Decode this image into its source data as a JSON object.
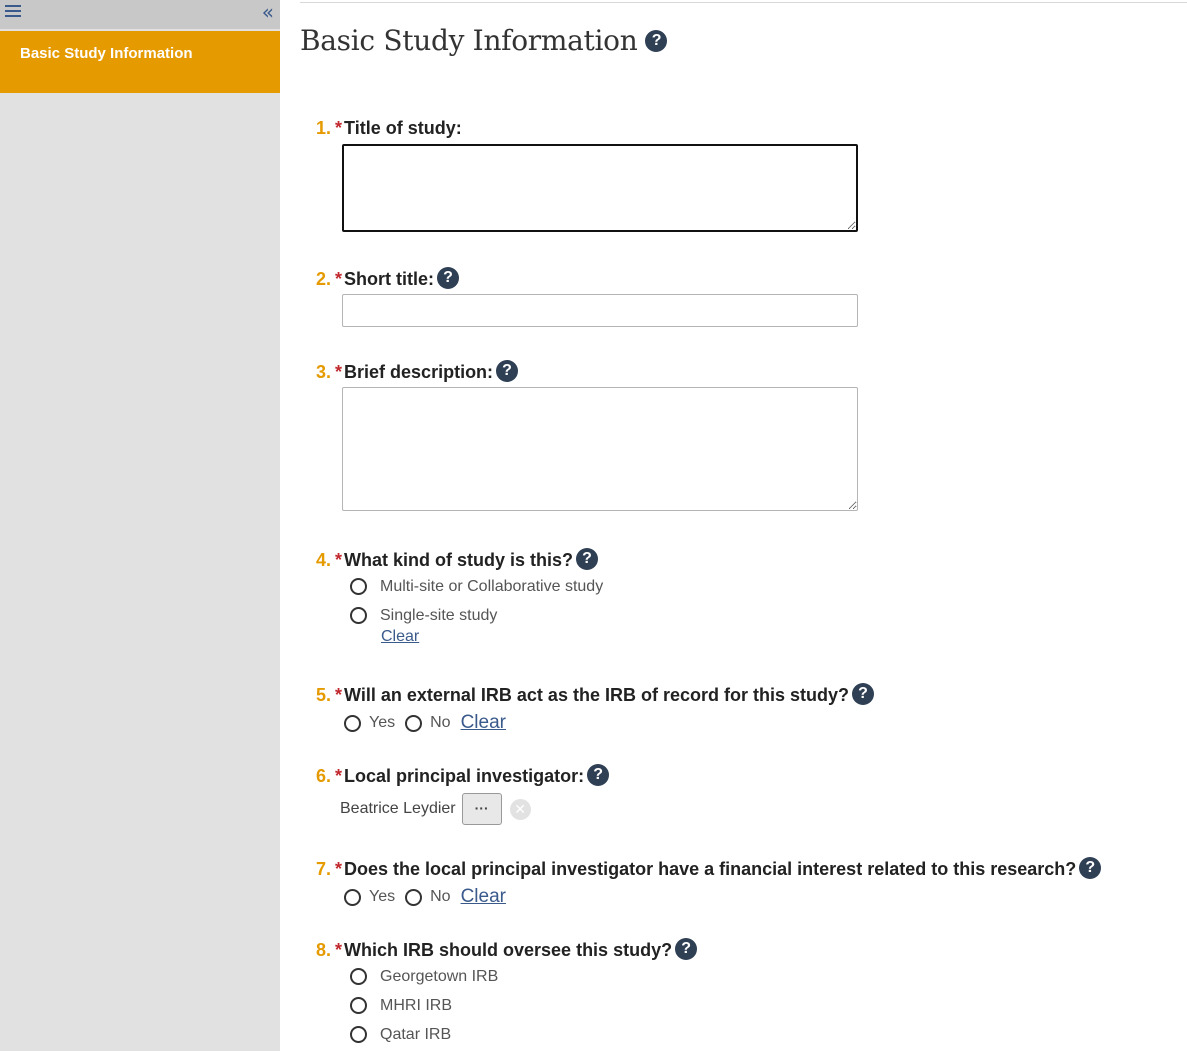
{
  "sidebar": {
    "menu_icon": "hamburger-menu-icon",
    "collapse_icon": "double-chevron-left-icon",
    "collapse_glyph": "«",
    "active_item": "Basic Study Information"
  },
  "main": {
    "page_title": "Basic Study Information",
    "help_glyph": "?"
  },
  "questions": [
    {
      "number": "1.",
      "required": "*",
      "label": "Title of study:"
    },
    {
      "number": "2.",
      "required": "*",
      "label": "Short title:"
    },
    {
      "number": "3.",
      "required": "*",
      "label": "Brief description:"
    },
    {
      "number": "4.",
      "required": "*",
      "label": "What kind of study is this?",
      "options": [
        "Multi-site or Collaborative study",
        "Single-site study"
      ],
      "clear": "Clear"
    },
    {
      "number": "5.",
      "required": "*",
      "label": "Will an external IRB act as the IRB of record for this study?",
      "options": [
        "Yes",
        "No"
      ],
      "clear": "Clear"
    },
    {
      "number": "6.",
      "required": "*",
      "label": "Local principal investigator:",
      "value": "Beatrice Leydier",
      "picker_label": "···",
      "remove_glyph": "✕"
    },
    {
      "number": "7.",
      "required": "*",
      "label": "Does the local principal investigator have a financial interest related to this research?",
      "options": [
        "Yes",
        "No"
      ],
      "clear": "Clear"
    },
    {
      "number": "8.",
      "required": "*",
      "label": "Which IRB should oversee this study?",
      "options": [
        "Georgetown IRB",
        "MHRI IRB",
        "Qatar IRB"
      ]
    }
  ],
  "colors": {
    "accent": "#e59a00",
    "required": "#c0282d",
    "link": "#3a5a8c",
    "help_icon": "#2f3f54"
  }
}
